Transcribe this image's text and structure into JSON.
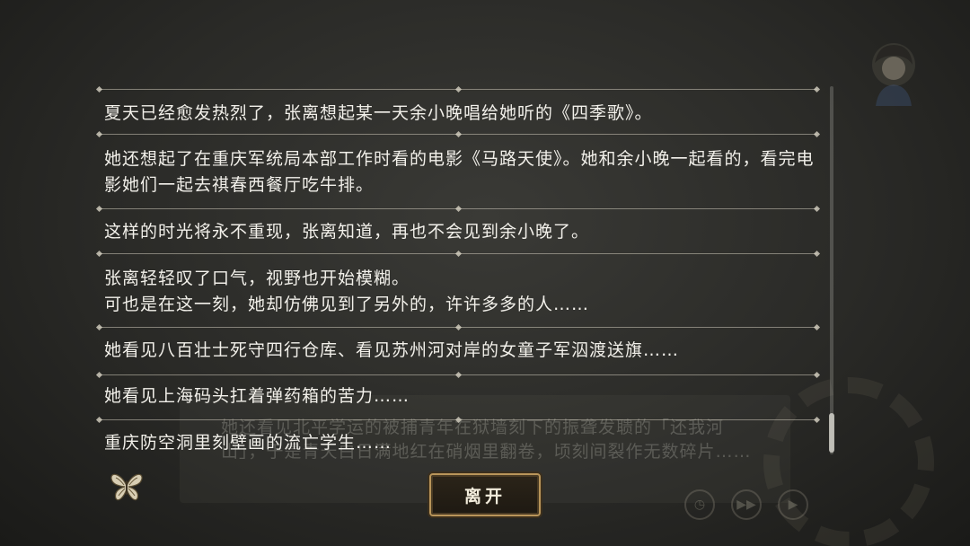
{
  "background": {
    "dialogue": "她还看见北平学运的被捕青年在狱墙刻下的振聋发聩的「还我河山」，于是青天白日满地红在硝烟里翻卷，顷刻间裂作无数碎片……"
  },
  "log": {
    "entries": [
      "夏天已经愈发热烈了，张离想起某一天余小晚唱给她听的《四季歌》。",
      "她还想起了在重庆军统局本部工作时看的电影《马路天使》。她和余小晚一起看的，看完电影她们一起去祺春西餐厅吃牛排。",
      "这样的时光将永不重现，张离知道，再也不会见到余小晚了。",
      "张离轻轻叹了口气，视野也开始模糊。\n可也是在这一刻，她却仿佛见到了另外的，许许多多的人……",
      "她看见八百壮士死守四行仓库、看见苏州河对岸的女童子军泅渡送旗……",
      "她看见上海码头扛着弹药箱的苦力……",
      "重庆防空洞里刻壁画的流亡学生……"
    ]
  },
  "buttons": {
    "leave_label": "离开"
  },
  "icons": {
    "butterfly": "butterfly-icon",
    "auto": "auto-play-icon",
    "skip": "skip-icon",
    "play": "play-icon"
  },
  "colors": {
    "accent": "#b9955a",
    "text": "#f2f0ea"
  }
}
